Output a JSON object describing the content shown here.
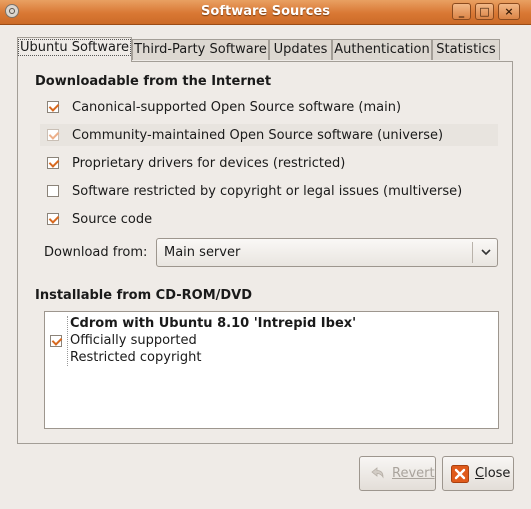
{
  "window": {
    "title": "Software Sources",
    "controls": {
      "minimize": "_",
      "maximize": "□",
      "close": "×"
    }
  },
  "tabs": [
    {
      "label": "Ubuntu Software",
      "active": true
    },
    {
      "label": "Third-Party Software",
      "active": false
    },
    {
      "label": "Updates",
      "active": false
    },
    {
      "label": "Authentication",
      "active": false
    },
    {
      "label": "Statistics",
      "active": false
    }
  ],
  "downloadable": {
    "title": "Downloadable from the Internet",
    "items": [
      {
        "label": "Canonical-supported Open Source software (main)",
        "checked": true,
        "insensitive": false
      },
      {
        "label": "Community-maintained Open Source software (universe)",
        "checked": true,
        "insensitive": true
      },
      {
        "label": "Proprietary drivers for devices (restricted)",
        "checked": true,
        "insensitive": false
      },
      {
        "label": "Software restricted by copyright or legal issues (multiverse)",
        "checked": false,
        "insensitive": false
      },
      {
        "label": "Source code",
        "checked": true,
        "insensitive": false
      }
    ],
    "download_from_label": "Download from:",
    "download_from_value": "Main server"
  },
  "cdrom": {
    "title": "Installable from CD-ROM/DVD",
    "entry": {
      "checked": true,
      "name": "Cdrom with Ubuntu 8.10 'Intrepid Ibex'",
      "line2": "Officially supported",
      "line3": "Restricted copyright"
    }
  },
  "buttons": {
    "revert_label": "Revert",
    "revert_enabled": false,
    "close_label": "Close"
  },
  "colors": {
    "titlebar": "#d97834",
    "check": "#d8691f",
    "close_icon": "#e05a1a"
  },
  "icons": {
    "window": "software-sources-icon",
    "revert": "revert-arrow-icon",
    "close": "close-x-icon",
    "combo": "chevron-down-icon"
  }
}
